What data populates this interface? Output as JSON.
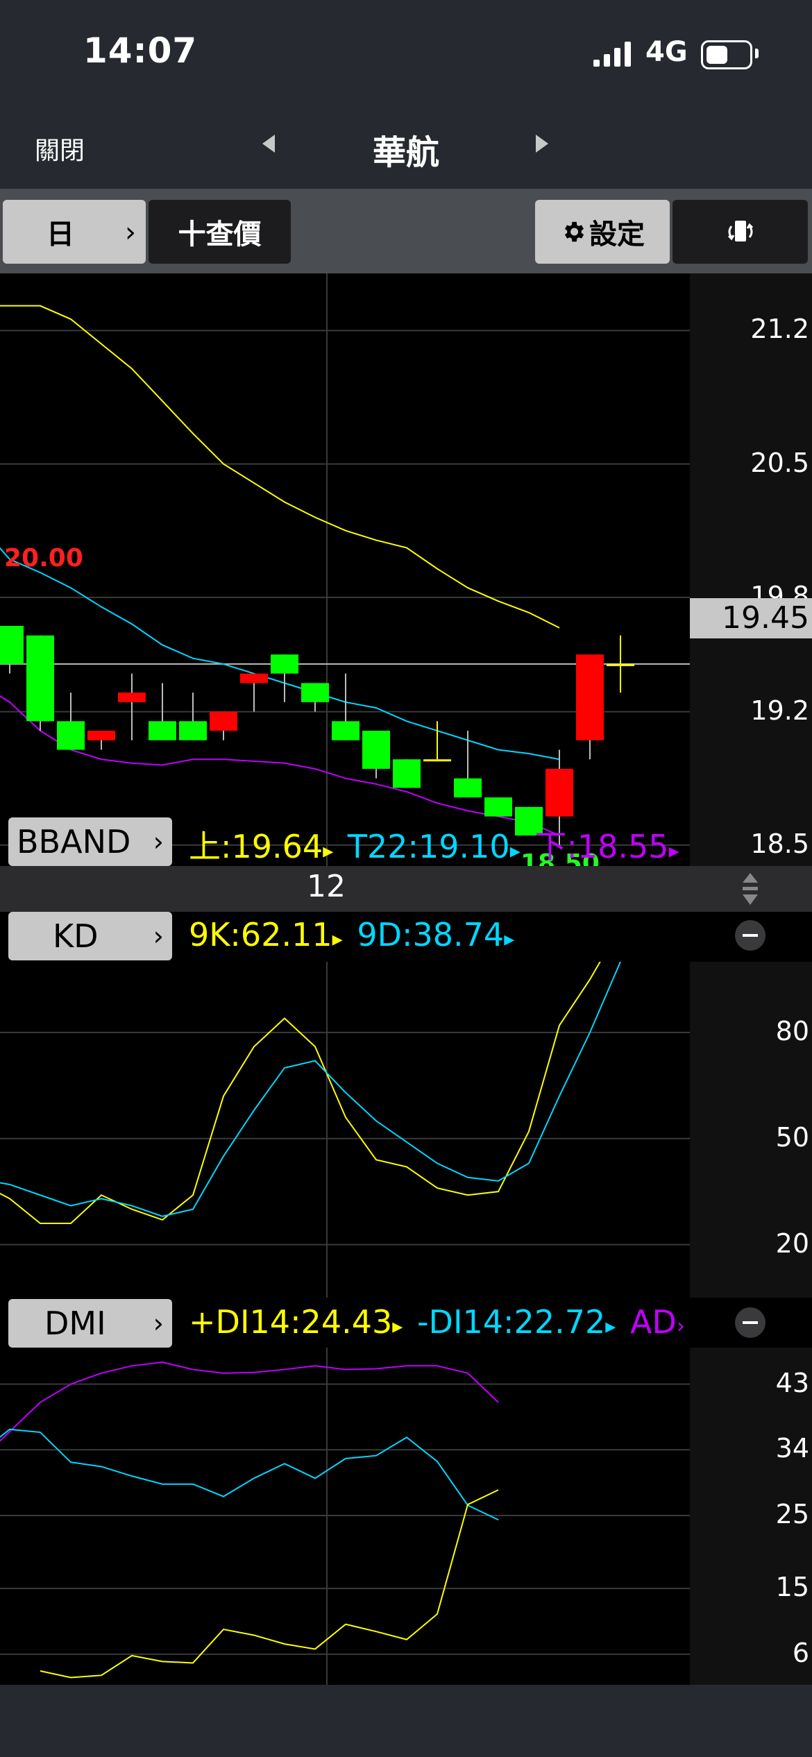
{
  "status_bar": {
    "time": "14:07",
    "network": "4G"
  },
  "nav": {
    "close_label": "關閉",
    "stock_name": "華航"
  },
  "toolbar": {
    "period_label": "日",
    "quote_label": "十查價",
    "settings_label": "設定"
  },
  "colors": {
    "up_candle": "#ff0000",
    "down_candle": "#00ff00",
    "upper_band": "#ffff00",
    "mid_band": "#00d8ff",
    "lower_band": "#c000ff",
    "k_line": "#ffff00",
    "d_line": "#00d8ff",
    "adx_line": "#c000ff"
  },
  "icons": {
    "settings": "gear-icon",
    "rotate": "rotate-phone-icon",
    "scroll": "up-down-arrows-icon",
    "remove": "minus-circle-icon"
  },
  "date_label": "12",
  "chart_data": [
    {
      "type": "candlestick",
      "indicator": "BBAND",
      "legend": {
        "label": "BBAND",
        "upper": "上:19.64",
        "mid": "T22:19.10",
        "lower": "下:18.55"
      },
      "y_ticks": [
        "21.2",
        "20.5",
        "19.8",
        "19.2",
        "18.5"
      ],
      "y_tick_values": [
        21.2,
        20.5,
        19.8,
        19.2,
        18.5
      ],
      "ylim": [
        18.39,
        21.5
      ],
      "current_price": "19.45",
      "high_annotation": "20.00",
      "low_annotation": "18.50",
      "candles": [
        {
          "o": 19.65,
          "h": 19.65,
          "l": 19.4,
          "c": 19.45
        },
        {
          "o": 19.6,
          "h": 19.6,
          "l": 19.1,
          "c": 19.15
        },
        {
          "o": 19.15,
          "h": 19.3,
          "l": 19.0,
          "c": 19.0
        },
        {
          "o": 19.05,
          "h": 19.1,
          "l": 19.0,
          "c": 19.1
        },
        {
          "o": 19.25,
          "h": 19.4,
          "l": 19.05,
          "c": 19.3
        },
        {
          "o": 19.15,
          "h": 19.35,
          "l": 19.1,
          "c": 19.05
        },
        {
          "o": 19.15,
          "h": 19.3,
          "l": 19.05,
          "c": 19.05
        },
        {
          "o": 19.1,
          "h": 19.1,
          "l": 19.05,
          "c": 19.2
        },
        {
          "o": 19.35,
          "h": 19.35,
          "l": 19.2,
          "c": 19.4
        },
        {
          "o": 19.5,
          "h": 19.5,
          "l": 19.25,
          "c": 19.4
        },
        {
          "o": 19.35,
          "h": 19.35,
          "l": 19.2,
          "c": 19.25
        },
        {
          "o": 19.15,
          "h": 19.4,
          "l": 19.05,
          "c": 19.05
        },
        {
          "o": 19.1,
          "h": 19.1,
          "l": 18.85,
          "c": 18.9
        },
        {
          "o": 18.95,
          "h": 18.95,
          "l": 18.8,
          "c": 18.8
        },
        {
          "o": 18.95,
          "h": 19.15,
          "l": 18.95,
          "c": 18.95
        },
        {
          "o": 18.85,
          "h": 19.1,
          "l": 18.75,
          "c": 18.75
        },
        {
          "o": 18.75,
          "h": 18.75,
          "l": 18.7,
          "c": 18.65
        },
        {
          "o": 18.7,
          "h": 18.7,
          "l": 18.55,
          "c": 18.55
        },
        {
          "o": 18.65,
          "h": 19.0,
          "l": 18.5,
          "c": 18.9
        },
        {
          "o": 19.05,
          "h": 19.45,
          "l": 18.95,
          "c": 19.5
        },
        {
          "o": 19.45,
          "h": 19.6,
          "l": 19.3,
          "c": 19.45
        }
      ],
      "upper_band": [
        21.33,
        21.33,
        21.33,
        21.26,
        21.13,
        21.0,
        20.83,
        20.66,
        20.5,
        20.4,
        20.3,
        20.22,
        20.15,
        20.1,
        20.06,
        19.95,
        19.85,
        19.78,
        19.72,
        19.64
      ],
      "mid_band": [
        20.18,
        20.0,
        19.93,
        19.85,
        19.75,
        19.66,
        19.55,
        19.48,
        19.45,
        19.4,
        19.35,
        19.3,
        19.25,
        19.22,
        19.15,
        19.1,
        19.05,
        19.0,
        18.98,
        18.95
      ],
      "lower_band": [
        19.35,
        19.25,
        19.1,
        19.0,
        18.95,
        18.93,
        18.92,
        18.95,
        18.95,
        18.94,
        18.93,
        18.9,
        18.85,
        18.82,
        18.78,
        18.72,
        18.68,
        18.65,
        18.62,
        18.55
      ]
    },
    {
      "type": "line",
      "indicator": "KD",
      "legend": {
        "label": "KD",
        "k": "9K:62.11",
        "d": "9D:38.74"
      },
      "y_ticks": [
        "80",
        "50",
        "20"
      ],
      "y_tick_values": [
        80,
        50,
        20
      ],
      "ylim": [
        5,
        100
      ],
      "series": [
        {
          "name": "9K",
          "values": [
            37.5,
            33,
            26,
            26,
            34,
            30,
            27,
            34,
            62,
            76,
            84,
            76,
            56,
            44,
            42,
            36,
            34,
            35,
            52,
            82,
            95,
            110
          ]
        },
        {
          "name": "9D",
          "values": [
            38.5,
            37,
            34,
            31,
            33,
            31,
            28,
            30,
            45,
            58,
            70,
            72,
            63,
            55,
            49,
            43,
            39,
            38,
            43,
            62,
            80,
            100
          ]
        }
      ]
    },
    {
      "type": "line",
      "indicator": "DMI",
      "legend": {
        "label": "DMI",
        "pdi": "+DI14:24.43",
        "mdi": "-DI14:22.72",
        "adx": "AD"
      },
      "y_ticks": [
        "43",
        "34",
        "25",
        "15",
        "6"
      ],
      "y_tick_values": [
        43,
        34,
        25,
        15,
        6
      ],
      "ylim": [
        1.8,
        48
      ],
      "series": [
        {
          "name": "ADX",
          "values": [
            32.5,
            36.5,
            40.5,
            43,
            44.5,
            45.5,
            46,
            45,
            44.5,
            44.6,
            45,
            45.5,
            45,
            45.1,
            45.5,
            45.5,
            44.5,
            40.5
          ]
        },
        {
          "name": "-DI14",
          "values": [
            33.5,
            36.8,
            36.4,
            32.3,
            31.7,
            30.4,
            29.3,
            29.3,
            27.6,
            30.1,
            32.1,
            30.1,
            32.8,
            33.2,
            35.7,
            32.4,
            26.4,
            24.4
          ]
        },
        {
          "name": "+DI14",
          "values": [
            3.7,
            2.8,
            3.1,
            5.8,
            5,
            4.8,
            9.4,
            8.6,
            7.4,
            6.7,
            10.1,
            9.1,
            8,
            11.5,
            26.5,
            28.5
          ]
        }
      ]
    }
  ]
}
